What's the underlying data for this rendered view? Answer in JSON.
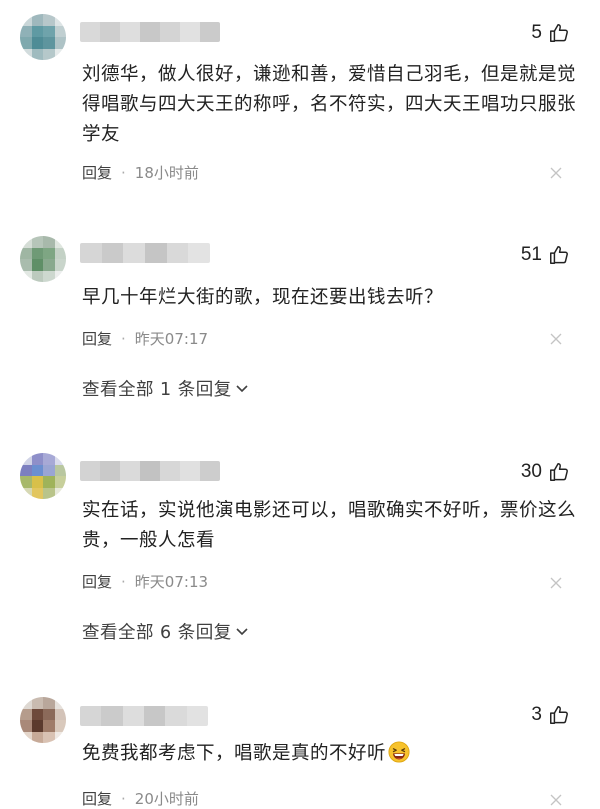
{
  "comments": [
    {
      "likes": "5",
      "text": "刘德华，做人很好，谦逊和善，爱惜自己羽毛，但是就是觉得唱歌与四大天王的称呼，名不符实，四大天王唱功只服张学友",
      "reply_label": "回复",
      "separator": "·",
      "time": "18小时前"
    },
    {
      "likes": "51",
      "text": "早几十年烂大街的歌，现在还要出钱去听？",
      "reply_label": "回复",
      "separator": "·",
      "time": "昨天07:17",
      "view_all": "查看全部 1 条回复"
    },
    {
      "likes": "30",
      "text": "实在话，实说他演电影还可以，唱歌确实不好听，票价这么贵，一般人怎看",
      "reply_label": "回复",
      "separator": "·",
      "time": "昨天07:13",
      "view_all": "查看全部 6 条回复"
    },
    {
      "likes": "3",
      "text": "免费我都考虑下，唱歌是真的不好听",
      "reply_label": "回复",
      "separator": "·",
      "time": "20小时前"
    }
  ],
  "icons": {
    "like": "thumbs-up-icon",
    "close": "close-icon",
    "expand": "chevron-down-icon",
    "emoji": "grinning-squinting-face-emoji"
  },
  "colors": {
    "text": "#222222",
    "meta": "#8a8a8a",
    "reply": "#404040"
  }
}
